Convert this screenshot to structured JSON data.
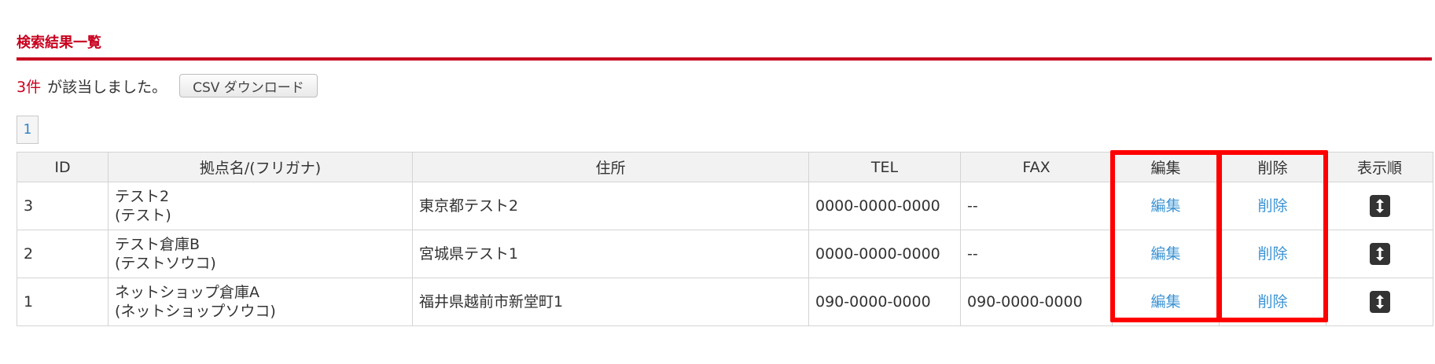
{
  "section": {
    "title": "検索結果一覧"
  },
  "summary": {
    "count": "3件",
    "message": "が該当しました。",
    "csv_button": "CSV ダウンロード"
  },
  "pagination": {
    "current_page": "1"
  },
  "table": {
    "headers": {
      "id": "ID",
      "name": "拠点名/(フリガナ)",
      "address": "住所",
      "tel": "TEL",
      "fax": "FAX",
      "edit": "編集",
      "delete": "削除",
      "order": "表示順"
    },
    "rows": [
      {
        "id": "3",
        "name": "テスト2",
        "kana": "(テスト)",
        "address": "東京都テスト2",
        "tel": "0000-0000-0000",
        "fax": "--",
        "edit": "編集",
        "delete": "削除"
      },
      {
        "id": "2",
        "name": "テスト倉庫B",
        "kana": "(テストソウコ)",
        "address": "宮城県テスト1",
        "tel": "0000-0000-0000",
        "fax": "--",
        "edit": "編集",
        "delete": "削除"
      },
      {
        "id": "1",
        "name": "ネットショップ倉庫A",
        "kana": "(ネットショップソウコ)",
        "address": "福井県越前市新堂町1",
        "tel": "090-0000-0000",
        "fax": "090-0000-0000",
        "edit": "編集",
        "delete": "削除"
      }
    ]
  },
  "icons": {
    "sort_handle": "sort-arrows-icon"
  },
  "colors": {
    "accent": "#c8001e",
    "link": "#3b93d3",
    "highlight": "#ff0000"
  }
}
